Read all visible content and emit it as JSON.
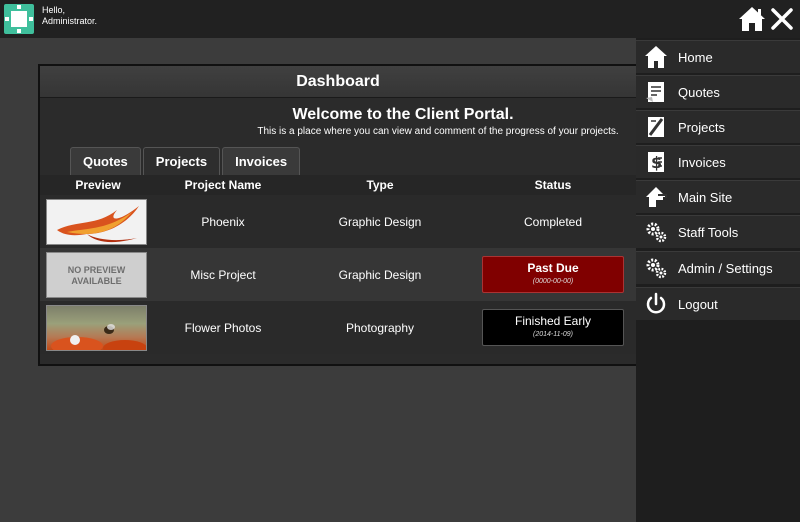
{
  "header": {
    "greeting": "Hello,",
    "user": "Administrator."
  },
  "panel": {
    "title": "Dashboard",
    "welcome": "Welcome to the Client Portal.",
    "subtitle": "This is a place where you can view and comment of the progress of your projects."
  },
  "tabs": [
    {
      "label": "Quotes",
      "active": false
    },
    {
      "label": "Projects",
      "active": true
    },
    {
      "label": "Invoices",
      "active": false
    }
  ],
  "table": {
    "headers": [
      "Preview",
      "Project Name",
      "Type",
      "Status"
    ],
    "rows": [
      {
        "preview": "phoenix image",
        "name": "Phoenix",
        "type": "Graphic Design",
        "status": "Completed",
        "date": ""
      },
      {
        "preview": "NO PREVIEW AVAILABLE",
        "name": "Misc Project",
        "type": "Graphic Design",
        "status": "Past Due",
        "date": "(0000-00-00)"
      },
      {
        "preview": "flower image",
        "name": "Flower Photos",
        "type": "Photography",
        "status": "Finished Early",
        "date": "(2014-11-09)"
      }
    ]
  },
  "menu": [
    {
      "label": "Home",
      "icon": "home-icon"
    },
    {
      "label": "Quotes",
      "icon": "quotes-icon"
    },
    {
      "label": "Projects",
      "icon": "projects-icon"
    },
    {
      "label": "Invoices",
      "icon": "invoices-icon"
    },
    {
      "label": "Main Site",
      "icon": "main-site-icon"
    },
    {
      "label": "Staff Tools",
      "icon": "gears-icon"
    },
    {
      "label": "Admin / Settings",
      "icon": "gears-icon"
    },
    {
      "label": "Logout",
      "icon": "power-icon"
    }
  ],
  "colors": {
    "accent": "#3fbf9c",
    "past_due": "#800000",
    "finished_early": "#000000"
  }
}
